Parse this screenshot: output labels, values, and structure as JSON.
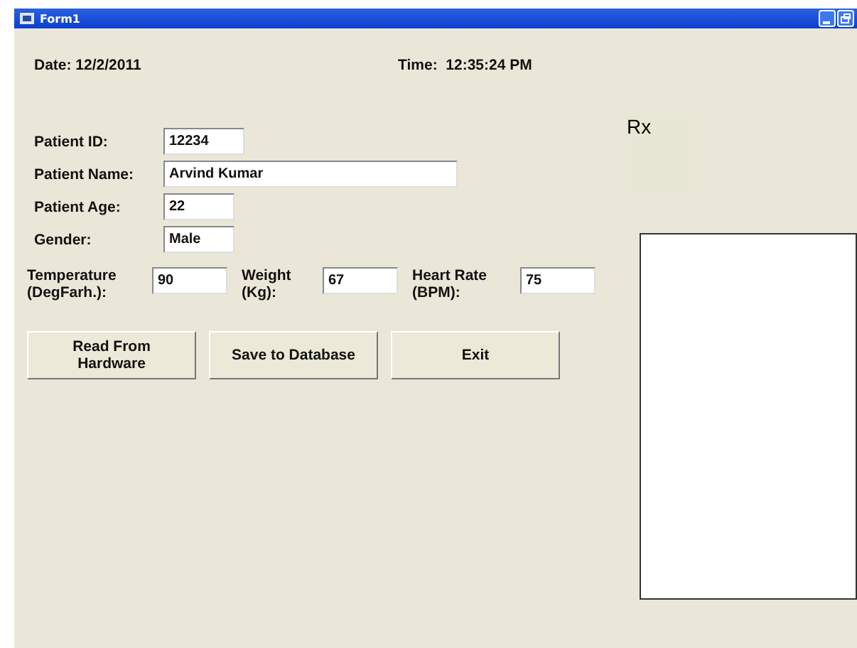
{
  "window": {
    "title": "Form1"
  },
  "date": {
    "label": "Date:",
    "value": "12/2/2011"
  },
  "time": {
    "label": "Time:",
    "value": "12:35:24 PM"
  },
  "patient_fields": [
    {
      "label": "Patient ID:",
      "value": "12234"
    },
    {
      "label": "Patient Name:",
      "value": "Arvind Kumar"
    },
    {
      "label": "Patient Age:",
      "value": "22"
    },
    {
      "label": "Gender:",
      "value": "Male"
    }
  ],
  "vitals": [
    {
      "label": "Temperature (DegFarh.):",
      "value": "90"
    },
    {
      "label": "Weight (Kg):",
      "value": "67"
    },
    {
      "label": "Heart Rate (BPM):",
      "value": "75"
    }
  ],
  "buttons": [
    "Read From Hardware",
    "Save to Database",
    "Exit"
  ],
  "rx_label": "Rx"
}
